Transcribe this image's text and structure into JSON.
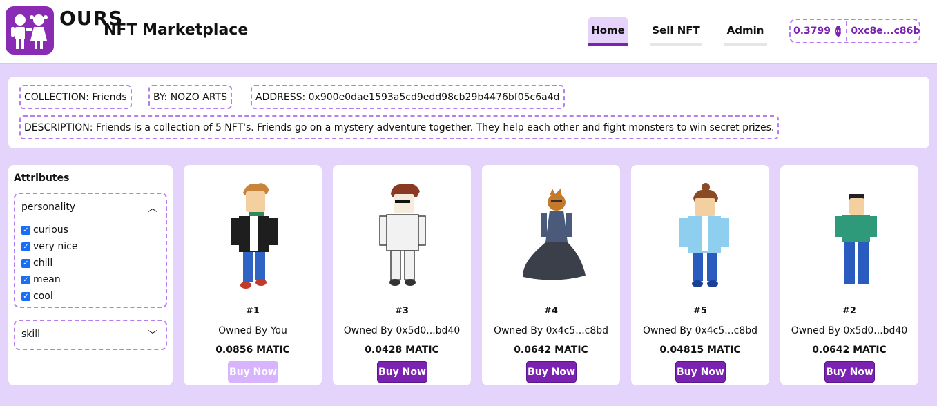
{
  "header": {
    "logo_text": "OURS",
    "app_title": "NFT Marketplace",
    "nav": {
      "home": "Home",
      "sell": "Sell NFT",
      "admin": "Admin"
    },
    "wallet": {
      "balance": "0.3799",
      "address": "0xc8e...c86b"
    }
  },
  "collection": {
    "collection": "COLLECTION: Friends",
    "by": "BY: NOZO ARTS",
    "address": "ADDRESS: 0x900e0dae1593a5cd9edd98cb29b4476bf05c6a4d",
    "description": "DESCRIPTION: Friends is a collection of 5 NFT's. Friends go on a mystery adventure together. They help each other and fight monsters to win secret prizes."
  },
  "sidebar": {
    "title": "Attributes",
    "personality": {
      "label": "personality",
      "options": [
        "curious",
        "very nice",
        "chill",
        "mean",
        "cool"
      ]
    },
    "skill": {
      "label": "skill"
    }
  },
  "cards": [
    {
      "num": "#1",
      "owner": "Owned By You",
      "price": "0.0856 MATIC",
      "buy": "Buy Now"
    },
    {
      "num": "#3",
      "owner": "Owned By 0x5d0...bd40",
      "price": "0.0428 MATIC",
      "buy": "Buy Now"
    },
    {
      "num": "#4",
      "owner": "Owned By 0x4c5...c8bd",
      "price": "0.0642 MATIC",
      "buy": "Buy Now"
    },
    {
      "num": "#5",
      "owner": "Owned By 0x4c5...c8bd",
      "price": "0.04815 MATIC",
      "buy": "Buy Now"
    },
    {
      "num": "#2",
      "owner": "Owned By 0x5d0...bd40",
      "price": "0.0642 MATIC",
      "buy": "Buy Now"
    }
  ],
  "colors": {
    "accent": "#7b22b0",
    "page_bg": "#e4d3fa",
    "dashed_border": "#b57ef0"
  },
  "icons": {
    "logo": "children-icon",
    "wallet_coin": "polygon-coin-icon",
    "collapse": "chevron-up-icon",
    "expand": "chevron-down-icon"
  }
}
